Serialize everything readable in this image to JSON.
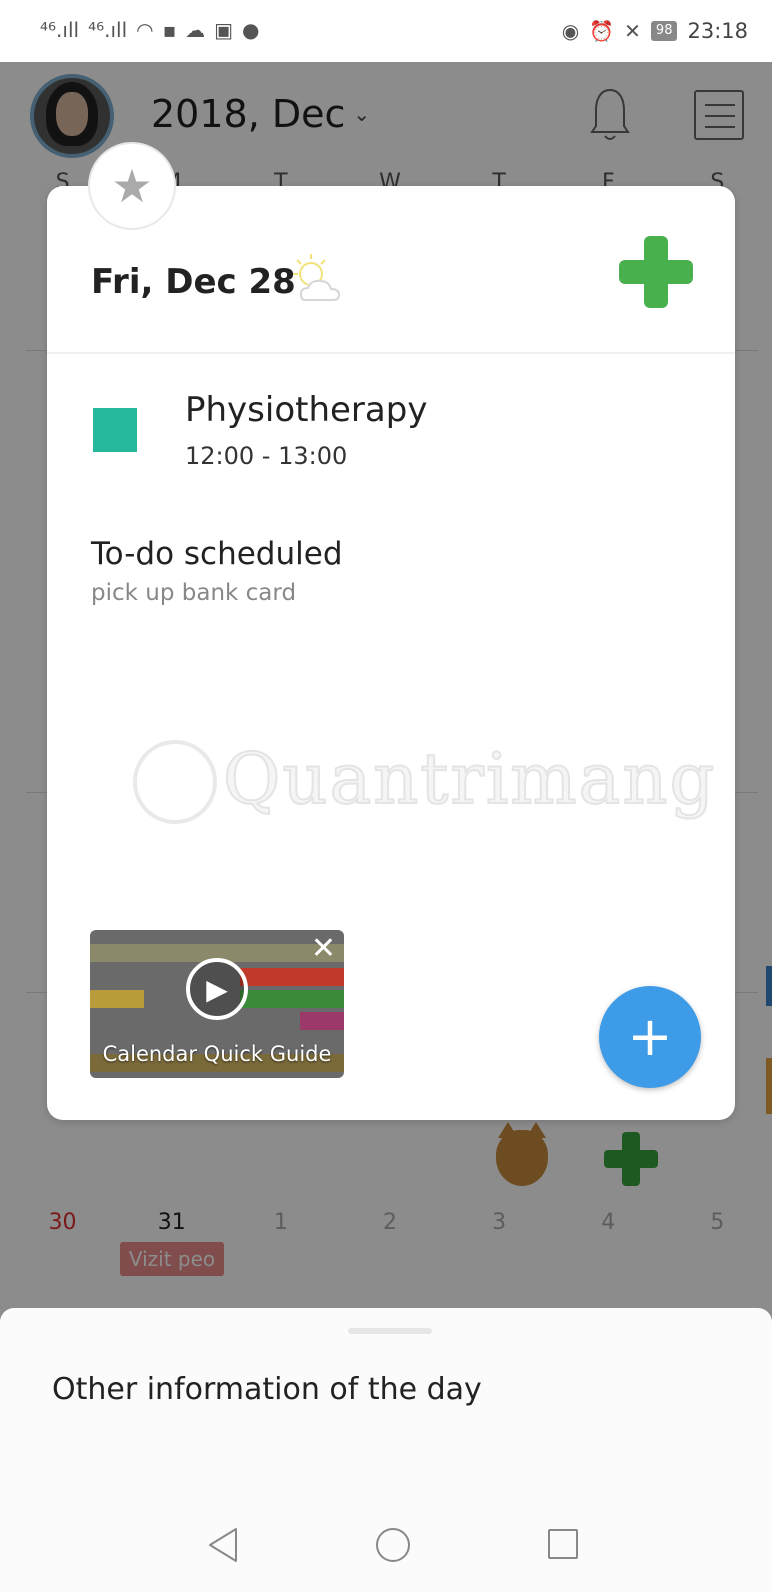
{
  "status_bar": {
    "signal_1": "⁴⁶.ıll",
    "signal_2": "⁴⁶.ıll",
    "battery": "98",
    "time": "23:18"
  },
  "calendar": {
    "month_title": "2018, Dec",
    "weekdays": [
      "S",
      "M",
      "T",
      "W",
      "T",
      "F",
      "S"
    ],
    "bottom_row_dates": [
      "30",
      "31",
      "1",
      "2",
      "3",
      "4",
      "5"
    ],
    "bottom_event_chip": "Vizit peo"
  },
  "day_card": {
    "date": "Fri, Dec 28",
    "events": [
      {
        "name": "Physiotherapy",
        "time": "12:00 - 13:00",
        "color": "#26b89d"
      }
    ],
    "todo_section_title": "To-do scheduled",
    "todo_items": [
      "pick up bank card"
    ],
    "quick_guide_label": "Calendar Quick Guide",
    "watermark_text": "Quantrimang",
    "fab_label": "+"
  },
  "bottom_sheet": {
    "title": "Other information of the day"
  },
  "icons": {
    "star": "star-icon",
    "weather": "partly-cloudy-icon",
    "add_sticker": "green-cross-icon",
    "play": "play-icon",
    "close": "close-icon",
    "bell": "bell-icon",
    "menu": "menu-icon"
  },
  "colors": {
    "accent_blue": "#3d9be8",
    "event_teal": "#26b89d",
    "sticker_green": "#48b04c",
    "sunday_red": "#e03030"
  }
}
